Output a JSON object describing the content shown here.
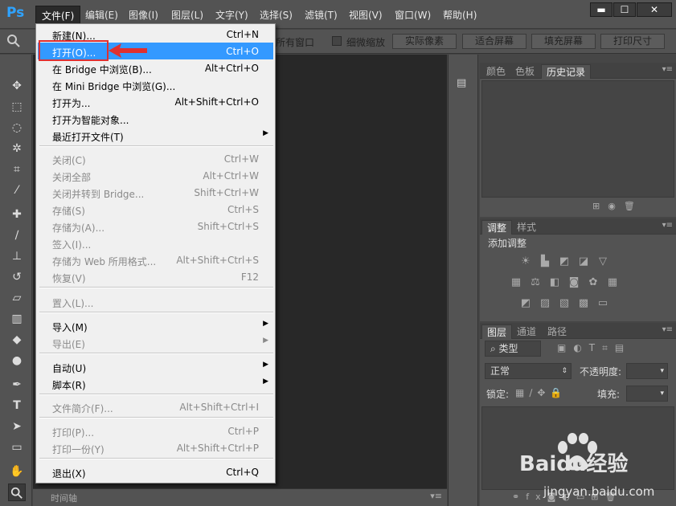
{
  "app": {
    "logo": "Ps"
  },
  "menubar": {
    "items": [
      "文件(F)",
      "编辑(E)",
      "图像(I)",
      "图层(L)",
      "文字(Y)",
      "选择(S)",
      "滤镜(T)",
      "视图(V)",
      "窗口(W)",
      "帮助(H)"
    ],
    "active": "文件(F)"
  },
  "window_controls": {
    "minimize": "▬",
    "maximize": "☐",
    "close": "✕"
  },
  "options_bar": {
    "all_windows_partial": "所有窗口",
    "scrubby_zoom": "细微缩放",
    "actual_pixels": "实际像素",
    "fit_screen": "适合屏幕",
    "fill_screen": "填充屏幕",
    "print_size": "打印尺寸"
  },
  "file_menu": {
    "items": [
      {
        "label": "新建(N)...",
        "shortcut": "Ctrl+N"
      },
      {
        "label": "打开(O)...",
        "shortcut": "Ctrl+O",
        "highlighted": true
      },
      {
        "label": "在 Bridge 中浏览(B)...",
        "shortcut": "Alt+Ctrl+O"
      },
      {
        "label": "在 Mini Bridge 中浏览(G)...",
        "shortcut": ""
      },
      {
        "label": "打开为...",
        "shortcut": "Alt+Shift+Ctrl+O"
      },
      {
        "label": "打开为智能对象...",
        "shortcut": ""
      },
      {
        "label": "最近打开文件(T)",
        "shortcut": "",
        "submenu": true
      },
      {
        "label": "关闭(C)",
        "shortcut": "Ctrl+W",
        "disabled": true
      },
      {
        "label": "关闭全部",
        "shortcut": "Alt+Ctrl+W",
        "disabled": true
      },
      {
        "label": "关闭并转到 Bridge...",
        "shortcut": "Shift+Ctrl+W",
        "disabled": true
      },
      {
        "label": "存储(S)",
        "shortcut": "Ctrl+S",
        "disabled": true
      },
      {
        "label": "存储为(A)...",
        "shortcut": "Shift+Ctrl+S",
        "disabled": true
      },
      {
        "label": "签入(I)...",
        "shortcut": "",
        "disabled": true
      },
      {
        "label": "存储为 Web 所用格式...",
        "shortcut": "Alt+Shift+Ctrl+S",
        "disabled": true
      },
      {
        "label": "恢复(V)",
        "shortcut": "F12",
        "disabled": true
      },
      {
        "label": "置入(L)...",
        "shortcut": "",
        "disabled": true
      },
      {
        "label": "导入(M)",
        "shortcut": "",
        "submenu": true
      },
      {
        "label": "导出(E)",
        "shortcut": "",
        "submenu": true,
        "disabled": true
      },
      {
        "label": "自动(U)",
        "shortcut": "",
        "submenu": true
      },
      {
        "label": "脚本(R)",
        "shortcut": "",
        "submenu": true
      },
      {
        "label": "文件简介(F)...",
        "shortcut": "Alt+Shift+Ctrl+I",
        "disabled": true
      },
      {
        "label": "打印(P)...",
        "shortcut": "Ctrl+P",
        "disabled": true
      },
      {
        "label": "打印一份(Y)",
        "shortcut": "Alt+Shift+Ctrl+P",
        "disabled": true
      },
      {
        "label": "退出(X)",
        "shortcut": "Ctrl+Q"
      }
    ]
  },
  "panels": {
    "top": {
      "tabs": [
        "颜色",
        "色板",
        "历史记录"
      ],
      "selected": "历史记录"
    },
    "adjustments": {
      "tabs": [
        "调整",
        "样式"
      ],
      "selected": "调整",
      "title": "添加调整"
    },
    "layers": {
      "tabs": [
        "图层",
        "通道",
        "路径"
      ],
      "selected": "图层",
      "filter_kind": "类型",
      "blend_mode": "正常",
      "opacity_label": "不透明度:",
      "lock_label": "锁定:",
      "fill_label": "填充:"
    }
  },
  "timeline": {
    "label": "时间轴"
  },
  "watermark": {
    "brand": "Baidu经验",
    "url": "jingyan.baidu.com"
  },
  "icons": {
    "search": "⌕",
    "move": "move-icon",
    "zoom": "zoom-icon"
  },
  "colors": {
    "highlight": "#3399ff",
    "annotation": "#e03030",
    "ps_blue": "#2fa3ff"
  }
}
